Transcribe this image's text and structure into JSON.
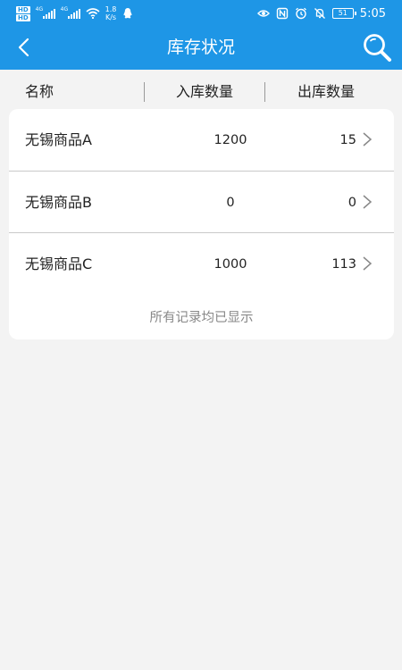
{
  "status_bar": {
    "hd_badges": [
      "HD",
      "HD"
    ],
    "network_1": "4G",
    "network_2": "4G",
    "speed_value": "1.8",
    "speed_unit": "K/s",
    "battery": "51",
    "time": "5:05"
  },
  "nav": {
    "title": "库存状况"
  },
  "table": {
    "headers": {
      "name": "名称",
      "in": "入库数量",
      "out": "出库数量"
    },
    "rows": [
      {
        "name": "无锡商品A",
        "in": "1200",
        "out": "15"
      },
      {
        "name": "无锡商品B",
        "in": "0",
        "out": "0"
      },
      {
        "name": "无锡商品C",
        "in": "1000",
        "out": "113"
      }
    ],
    "footer": "所有记录均已显示"
  },
  "colors": {
    "primary": "#1e96e6",
    "background": "#f3f3f3",
    "card": "#ffffff",
    "muted_text": "#888888"
  }
}
